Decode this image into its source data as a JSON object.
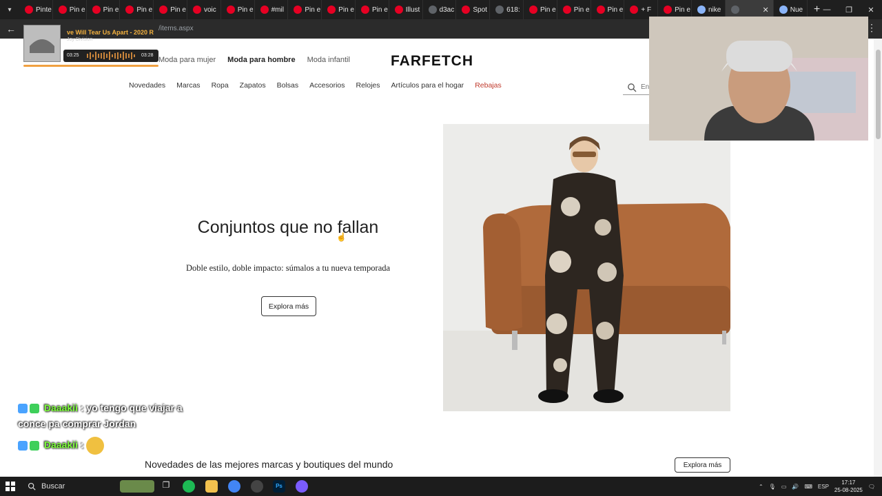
{
  "browser": {
    "tabs": [
      {
        "label": "Pinte",
        "icon": "pinterest-icon"
      },
      {
        "label": "Pin e",
        "icon": "pinterest-icon"
      },
      {
        "label": "Pin e",
        "icon": "pinterest-icon"
      },
      {
        "label": "Pin e",
        "icon": "pinterest-icon"
      },
      {
        "label": "Pin e",
        "icon": "pinterest-icon"
      },
      {
        "label": "voic",
        "icon": "pinterest-icon"
      },
      {
        "label": "Pin e",
        "icon": "pinterest-icon"
      },
      {
        "label": "#mil",
        "icon": "pinterest-icon"
      },
      {
        "label": "Pin e",
        "icon": "pinterest-icon"
      },
      {
        "label": "Pin e",
        "icon": "pinterest-icon"
      },
      {
        "label": "Pin e",
        "icon": "pinterest-icon"
      },
      {
        "label": "Illust",
        "icon": "pinterest-icon"
      },
      {
        "label": "d3ac",
        "icon": "globe-icon"
      },
      {
        "label": "Spot",
        "icon": "pinterest-icon"
      },
      {
        "label": "618:",
        "icon": "globe-icon"
      },
      {
        "label": "Pin e",
        "icon": "pinterest-icon"
      },
      {
        "label": "Pin e",
        "icon": "pinterest-icon"
      },
      {
        "label": "Pin e",
        "icon": "pinterest-icon"
      },
      {
        "label": "+ F",
        "icon": "pinterest-icon"
      },
      {
        "label": "Pin e",
        "icon": "pinterest-icon"
      },
      {
        "label": "nike",
        "icon": "google-icon"
      }
    ],
    "active_tab_label": "",
    "last_tab_label": "Nue",
    "url": "/items.aspx"
  },
  "site": {
    "logo": "FARFETCH",
    "gender_nav": [
      "Moda para mujer",
      "Moda para hombre",
      "Moda infantil"
    ],
    "category_nav": [
      "Novedades",
      "Marcas",
      "Ropa",
      "Zapatos",
      "Bolsas",
      "Accesorios",
      "Relojes",
      "Artículos para el hogar"
    ],
    "sale_link": "Rebajas",
    "search_placeholder": "En"
  },
  "hero": {
    "title": "Conjuntos que no fallan",
    "subtitle": "Doble estilo, doble impacto: súmalos a tu nueva temporada",
    "button": "Explora más"
  },
  "section": {
    "title": "Novedades de las mejores marcas y boutiques del mundo",
    "button": "Explora más"
  },
  "music": {
    "title": "ve Will Tear Us Apart - 2020 R",
    "artist": "Joy Division",
    "elapsed": "03:25",
    "total": "03:28"
  },
  "chat": [
    {
      "user": "Daaakii",
      "message": "yo tengo que viajar a conce pa comprar Jordan"
    },
    {
      "user": "Daaakii",
      "message": ""
    }
  ],
  "taskbar": {
    "search": "Buscar",
    "lang": "ESP",
    "time": "17:17",
    "date": "25-08-2025"
  }
}
